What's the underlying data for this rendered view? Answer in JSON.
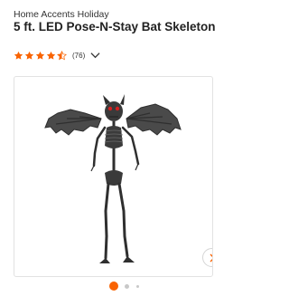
{
  "product": {
    "brand": "Home Accents Holiday",
    "title": "5 ft. LED Pose-N-Stay Bat Skeleton"
  },
  "rating": {
    "stars": 4.5,
    "count_label": "(76)",
    "star_color": "#f96302",
    "icon": "chevron-down-icon"
  },
  "gallery": {
    "image_subject": "bat-skeleton",
    "next_icon": "chevron-right-icon",
    "slides_total": 3,
    "active_slide": 1,
    "active_dot_color": "#f96302",
    "inactive_dot_color": "#c8c8c8"
  }
}
